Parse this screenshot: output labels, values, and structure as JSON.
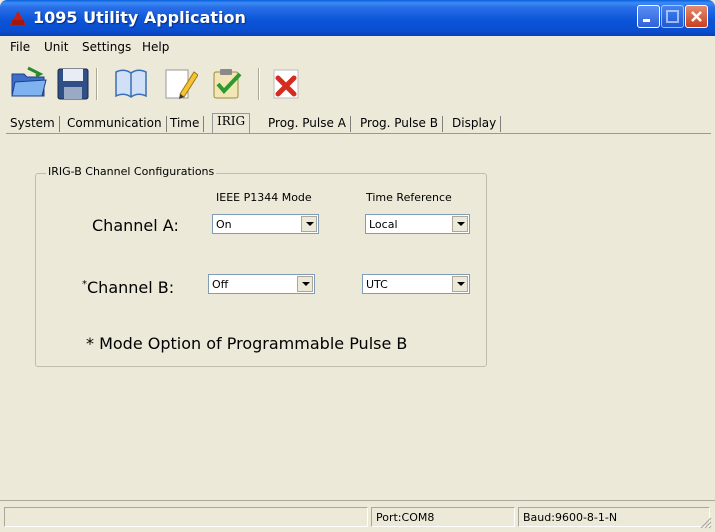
{
  "window": {
    "title": "1095 Utility Application"
  },
  "menu": [
    "File",
    "Unit",
    "Settings",
    "Help"
  ],
  "toolbar": {
    "icons": [
      "open-folder-icon",
      "save-disk-icon",
      "book-icon",
      "pencil-icon",
      "clipboard-check-icon",
      "delete-x-icon"
    ]
  },
  "tabs": [
    {
      "label": "System"
    },
    {
      "label": "Communication"
    },
    {
      "label": "Time"
    },
    {
      "label": "IRIG"
    },
    {
      "label": "Prog. Pulse A"
    },
    {
      "label": "Prog. Pulse B"
    },
    {
      "label": "Display"
    }
  ],
  "active_tab": "IRIG",
  "irig": {
    "group_title": "IRIG-B Channel Configurations",
    "col_mode": "IEEE P1344 Mode",
    "col_ref": "Time Reference",
    "channel_a": {
      "label": "Channel A:",
      "mode": "On",
      "ref": "Local"
    },
    "channel_b": {
      "prefix": "*",
      "label": "Channel B:",
      "mode": "Off",
      "ref": "UTC"
    },
    "note": "* Mode Option of Programmable Pulse B"
  },
  "status": {
    "port": "Port:COM8",
    "baud": "Baud:9600-8-1-N"
  },
  "colors": {
    "titlebar": "#0a55d8",
    "window_bg": "#ece9d8",
    "close_button": "#c8401f"
  }
}
